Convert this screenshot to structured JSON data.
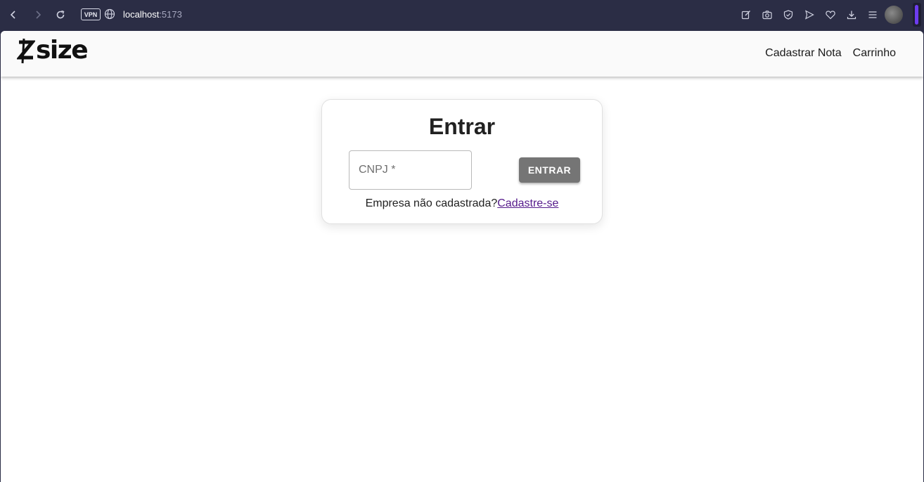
{
  "browser": {
    "vpn_label": "VPN",
    "url_host": "localhost",
    "url_port": ":5173",
    "accent_color": "#6d3cf0"
  },
  "header": {
    "logo_text": "size",
    "nav": [
      {
        "label": "Cadastrar Nota"
      },
      {
        "label": "Carrinho"
      }
    ]
  },
  "login": {
    "title": "Entrar",
    "cnpj_placeholder": "CNPJ *",
    "cnpj_value": "",
    "submit_label": "ENTRAR",
    "signup_prompt": "Empresa não cadastrada?",
    "signup_link": "Cadastre-se",
    "button_color": "#757575",
    "link_color": "#551a8b"
  }
}
